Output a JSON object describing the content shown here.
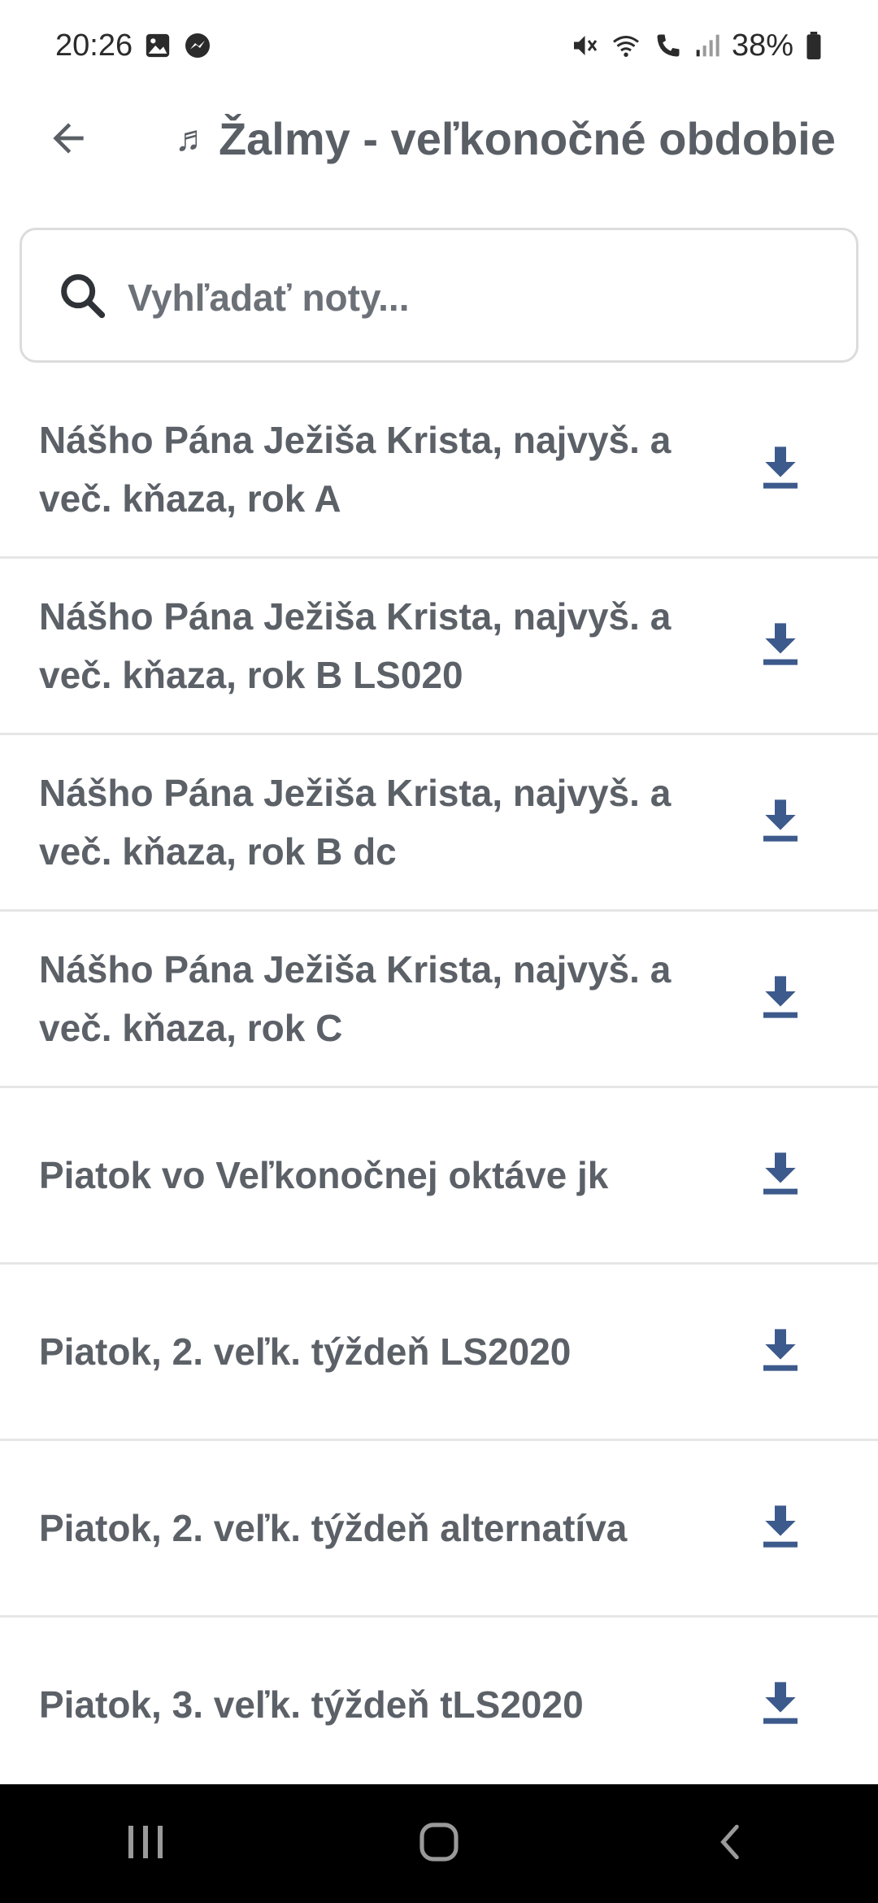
{
  "status_bar": {
    "time": "20:26",
    "battery": "38%",
    "left_icons": [
      "gallery-icon",
      "messenger-icon"
    ],
    "right_icons": [
      "mute-icon",
      "wifi-icon",
      "wifi-calling-icon",
      "signal-icon",
      "battery-icon"
    ]
  },
  "header": {
    "back_icon": "arrow-left-icon",
    "note_glyph": "♬",
    "title": "Žalmy - veľkonočné obdobie"
  },
  "search": {
    "placeholder": "Vyhľadať noty...",
    "value": ""
  },
  "items": [
    {
      "label": "Nášho Pána Ježiša Krista, najvyš. a več. kňaza, rok A"
    },
    {
      "label": "Nášho Pána Ježiša Krista, najvyš. a več. kňaza, rok B LS020"
    },
    {
      "label": "Nášho Pána Ježiša Krista, najvyš. a več. kňaza, rok B dc"
    },
    {
      "label": "Nášho Pána Ježiša Krista, najvyš. a več. kňaza, rok C"
    },
    {
      "label": "Piatok vo Veľkonočnej oktáve jk"
    },
    {
      "label": "Piatok, 2. veľk. týždeň LS2020"
    },
    {
      "label": "Piatok, 2. veľk. týždeň alternatíva"
    },
    {
      "label": "Piatok, 3. veľk. týždeň tLS2020"
    }
  ],
  "colors": {
    "accent": "#3d5a8c",
    "text": "#5c6168",
    "divider": "#e6e6e6",
    "navbar": "#000000"
  },
  "nav": [
    "recent-apps-icon",
    "home-icon",
    "back-icon"
  ]
}
